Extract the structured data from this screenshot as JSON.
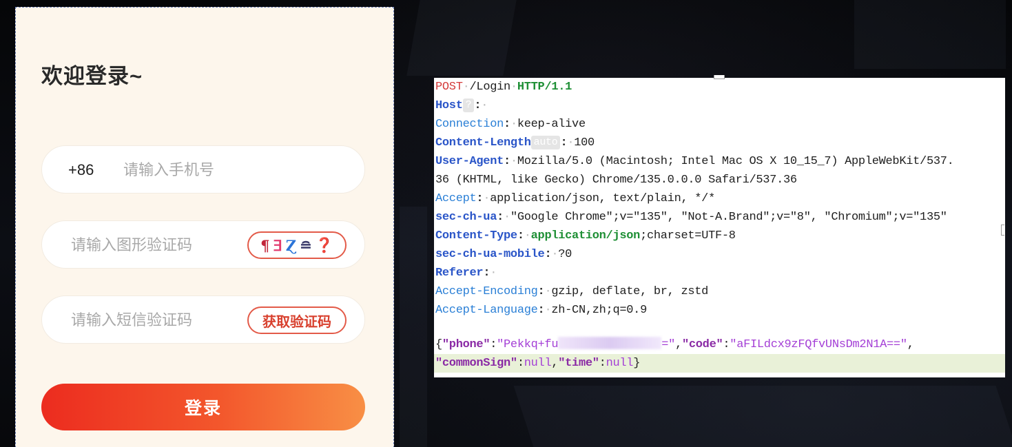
{
  "login": {
    "title": "欢迎登录~",
    "phone": {
      "prefix": "+86",
      "placeholder": "请输入手机号"
    },
    "captcha": {
      "placeholder": "请输入图形验证码",
      "image_glyphs": [
        "¶",
        "ⴺ",
        "Ɀ",
        "≘",
        "❓"
      ]
    },
    "sms": {
      "placeholder": "请输入短信验证码",
      "button_label": "获取验证码"
    },
    "submit_label": "登录"
  },
  "request": {
    "method": "POST",
    "path": "/Login",
    "protocol": "HTTP/1.1",
    "host_name": "Host",
    "host_badge": "?",
    "connection_name": "Connection",
    "connection_value": "keep-alive",
    "content_length_name": "Content-Length",
    "content_length_badge": "auto",
    "content_length_value": "100",
    "user_agent_name": "User-Agent",
    "user_agent_value_1": "Mozilla/5.0 (Macintosh; Intel Mac OS X 10_15_7) AppleWebKit/537.",
    "user_agent_value_2": "36 (KHTML, like Gecko) Chrome/135.0.0.0 Safari/537.36",
    "accept_name": "Accept",
    "accept_value": "application/json, text/plain, */*",
    "sec_ch_ua_name": "sec-ch-ua",
    "sec_ch_ua_value": "\"Google Chrome\";v=\"135\", \"Not-A.Brand\";v=\"8\", \"Chromium\";v=\"135\"",
    "content_type_name": "Content-Type",
    "content_type_mime": "application/json",
    "content_type_rest": ";charset=UTF-8",
    "mobile_name": "sec-ch-ua-mobile",
    "mobile_value": "?0",
    "referer_name": "Referer",
    "encoding_name": "Accept-Encoding",
    "encoding_value": "gzip, deflate, br, zstd",
    "language_name": "Accept-Language",
    "language_value": "zh-CN,zh;q=0.9",
    "body": {
      "phone_key": "\"phone\"",
      "phone_value_visible": "\"Pekkq+fu",
      "phone_value_end": "=\"",
      "code_key": "\"code\"",
      "code_value": "\"aFILdcx9zFQfvUNsDm2N1A==\"",
      "common_sign_key": "\"commonSign\"",
      "common_sign_value": "null",
      "time_key": "\"time\"",
      "time_value": "null"
    }
  }
}
